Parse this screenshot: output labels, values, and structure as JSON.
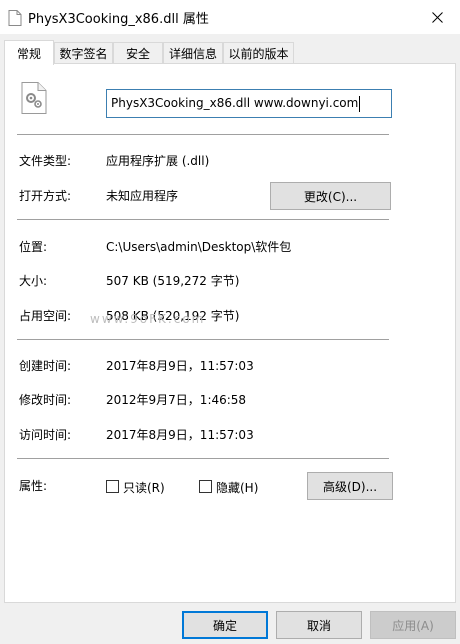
{
  "window": {
    "title": "PhysX3Cooking_x86.dll 属性",
    "close_glyph": "✕"
  },
  "tabs": [
    {
      "label": "常规",
      "active": true
    },
    {
      "label": "数字签名",
      "active": false
    },
    {
      "label": "安全",
      "active": false
    },
    {
      "label": "详细信息",
      "active": false
    },
    {
      "label": "以前的版本",
      "active": false
    }
  ],
  "general": {
    "file_icon": "dll-file-gear-icon",
    "filename": "PhysX3Cooking_x86.dll www.downyi.com",
    "file_type_label": "文件类型:",
    "file_type_value": "应用程序扩展 (.dll)",
    "open_with_label": "打开方式:",
    "open_with_value": "未知应用程序",
    "change_button": "更改(C)...",
    "location_label": "位置:",
    "location_value": "C:\\Users\\admin\\Desktop\\软件包",
    "size_label": "大小:",
    "size_value": "507 KB (519,272 字节)",
    "size_on_disk_label": "占用空间:",
    "size_on_disk_value": "508 KB (520,192 字节)",
    "created_label": "创建时间:",
    "created_value": "2017年8月9日，11:57:03",
    "modified_label": "修改时间:",
    "modified_value": "2012年9月7日，1:46:58",
    "accessed_label": "访问时间:",
    "accessed_value": "2017年8月9日，11:57:03",
    "attributes_label": "属性:",
    "readonly_label": "只读(R)",
    "readonly_checked": false,
    "hidden_label": "隐藏(H)",
    "hidden_checked": false,
    "advanced_button": "高级(D)..."
  },
  "watermark": "www.9oFK.com",
  "footer": {
    "ok": "确定",
    "cancel": "取消",
    "apply": "应用(A)"
  },
  "colors": {
    "focus_blue": "#0078d7",
    "input_border": "#3c7fb1",
    "panel_bg": "#ffffff",
    "window_bg": "#f0f0f0"
  }
}
